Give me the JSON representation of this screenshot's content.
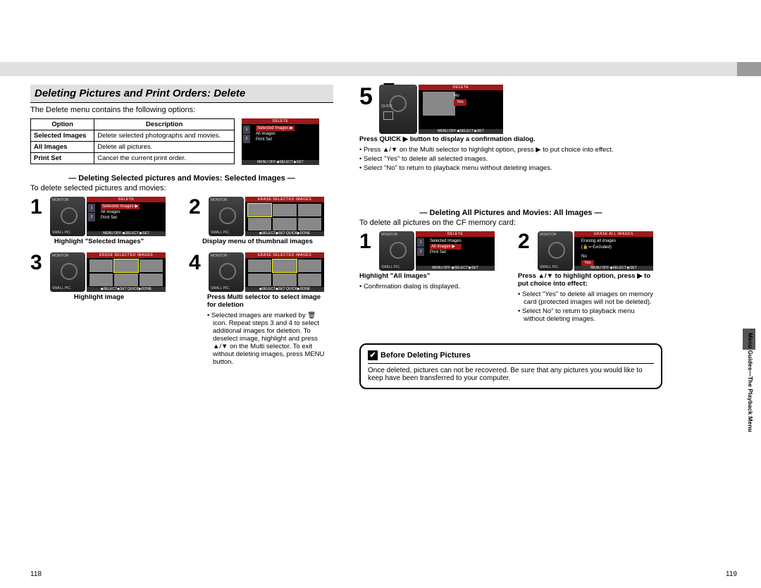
{
  "header": {
    "section_title": "Deleting Pictures and Print Orders: Delete",
    "intro": "The Delete menu contains the following options:"
  },
  "options_table": {
    "col_option": "Option",
    "col_desc": "Description",
    "rows": [
      {
        "opt": "Selected Images",
        "desc": "Delete selected photographs and movies."
      },
      {
        "opt": "All Images",
        "desc": "Delete all pictures."
      },
      {
        "opt": "Print Set",
        "desc": "Cancel the current print order."
      }
    ]
  },
  "selected_section": {
    "header": "— Deleting Selected pictures and Movies: Selected Images —",
    "intro": "To delete selected pictures and movies:",
    "lcd": {
      "delete_title": "DELETE",
      "erase_title": "ERASE SELECTED IMAGES",
      "menu_selected": "Selected Images ▶",
      "menu_all": "All images",
      "menu_print": "Print Set",
      "footer1_menu": "MENU OFF",
      "footer1_select": "◆SELECT",
      "footer1_set": "▶SET",
      "footer2a": "◆SELECT◆SET",
      "footer2b": "QUICK▶DONE"
    },
    "captions": {
      "s1": "Highlight \"Selected Images\"",
      "s2": "Display menu of thumbnail images",
      "s3": "Highlight image",
      "s4a": "Press Multi selector to select image for deletion",
      "s4_b1": "Selected images are marked by 🗑 icon. Repeat steps 3 and 4 to select additional images for deletion. To deselect image, highlight and press ▲/▼ on the Multi selector. To exit without deleting images, press MENU button."
    }
  },
  "step5": {
    "lcd_title": "DELETE",
    "dlg_no": "No",
    "dlg_yes": "Yes",
    "footer": "MENU OFF   ◆SELECT   ▶SET",
    "quick_lbl": "QUICK",
    "cap_a": "Press QUICK ▶ button to display a confirmation dialog.",
    "b1": "Press ▲/▼ on the Multi selector to highlight option, press ▶ to put choice into effect.",
    "b2": "Select \"Yes\" to delete all selected images.",
    "b3": "Select \"No\" to return to playback menu without deleting images."
  },
  "all_section": {
    "header": "— Deleting All Pictures and Movies: All Images —",
    "intro": "To delete all pictures on the CF memory card:",
    "lcd": {
      "delete_title": "DELETE",
      "erase_title": "ERASE ALL IMAGES",
      "menu_selected": "Selected Images",
      "menu_all": "All images ▶",
      "menu_print": "Print Set",
      "e_line1": "Erasing all images",
      "e_line2": "(🔒⇒ Excluded)",
      "no": "No",
      "yes": "Yes",
      "footer1": "MENU OFF   ◆SELECT   ▶SET",
      "footer2": "MENU OFF   ◆SELECT   ▶SET"
    },
    "captions": {
      "s1": "Highlight \"All Images\"",
      "s1_b1": "Confirmation dialog is displayed.",
      "s2a": "Press ▲/▼ to highlight option, press ▶ to put choice into effect:",
      "s2_b1": "Select \"Yes\" to delete all images on memory card (protected images will not be deleted).",
      "s2_b2": "Select No\" to return to playback menu without deleting images."
    }
  },
  "info_box": {
    "title": "Before Deleting Pictures",
    "body": "Once deleted, pictures can not be recovered. Be sure that any pictures you would like to keep have been transferred to your computer."
  },
  "page_numbers": {
    "left": "118",
    "right": "119"
  },
  "side_tab": "Menu Guides—The Playback Menu",
  "labels": {
    "monitor": "MONITOR",
    "smallpic": "SMALL PIC."
  }
}
